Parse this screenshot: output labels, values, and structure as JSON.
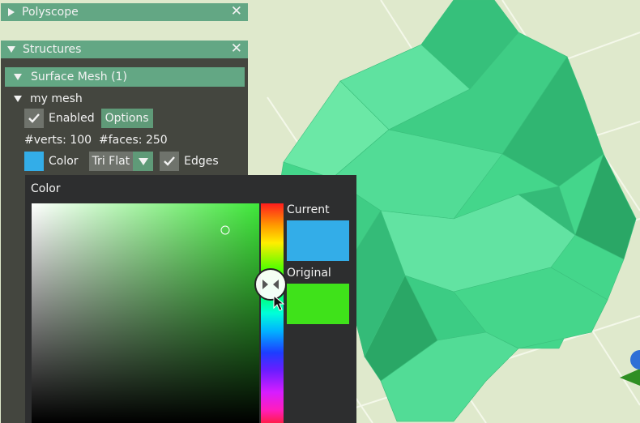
{
  "colors": {
    "ground": "#dfe9cc",
    "grid": "#f2f7e6",
    "mesh": "#45d98e",
    "mesh_light": "#6be8a6",
    "mesh_dark": "#259a63",
    "panel": "#3a3c36",
    "title_bar": "#63a784",
    "accent": "#5f9a78",
    "current_color": "#33ade8",
    "original_color": "#3fe21a"
  },
  "polyscope_window": {
    "title": "Polyscope",
    "collapse_icon": "triangle-right-icon",
    "close_icon": "close-icon",
    "close_glyph": "✕"
  },
  "structures_window": {
    "title": "Structures",
    "collapse_icon": "triangle-down-icon",
    "close_glyph": "✕",
    "group_header": "Surface Mesh (1)",
    "mesh_name": "my mesh",
    "enabled_label": "Enabled",
    "enabled": true,
    "options_button": "Options",
    "stats": "#verts: 100  #faces: 250",
    "color_label": "Color",
    "shading_mode": "Tri Flat",
    "edges_label": "Edges",
    "edges_enabled": true
  },
  "color_picker": {
    "title": "Color",
    "current_label": "Current",
    "original_label": "Original",
    "current_color": "#33ade8",
    "original_color": "#3fe21a",
    "picker_hue_fraction": 0.37,
    "picker_saturation": 0.85,
    "picker_value": 0.88
  }
}
